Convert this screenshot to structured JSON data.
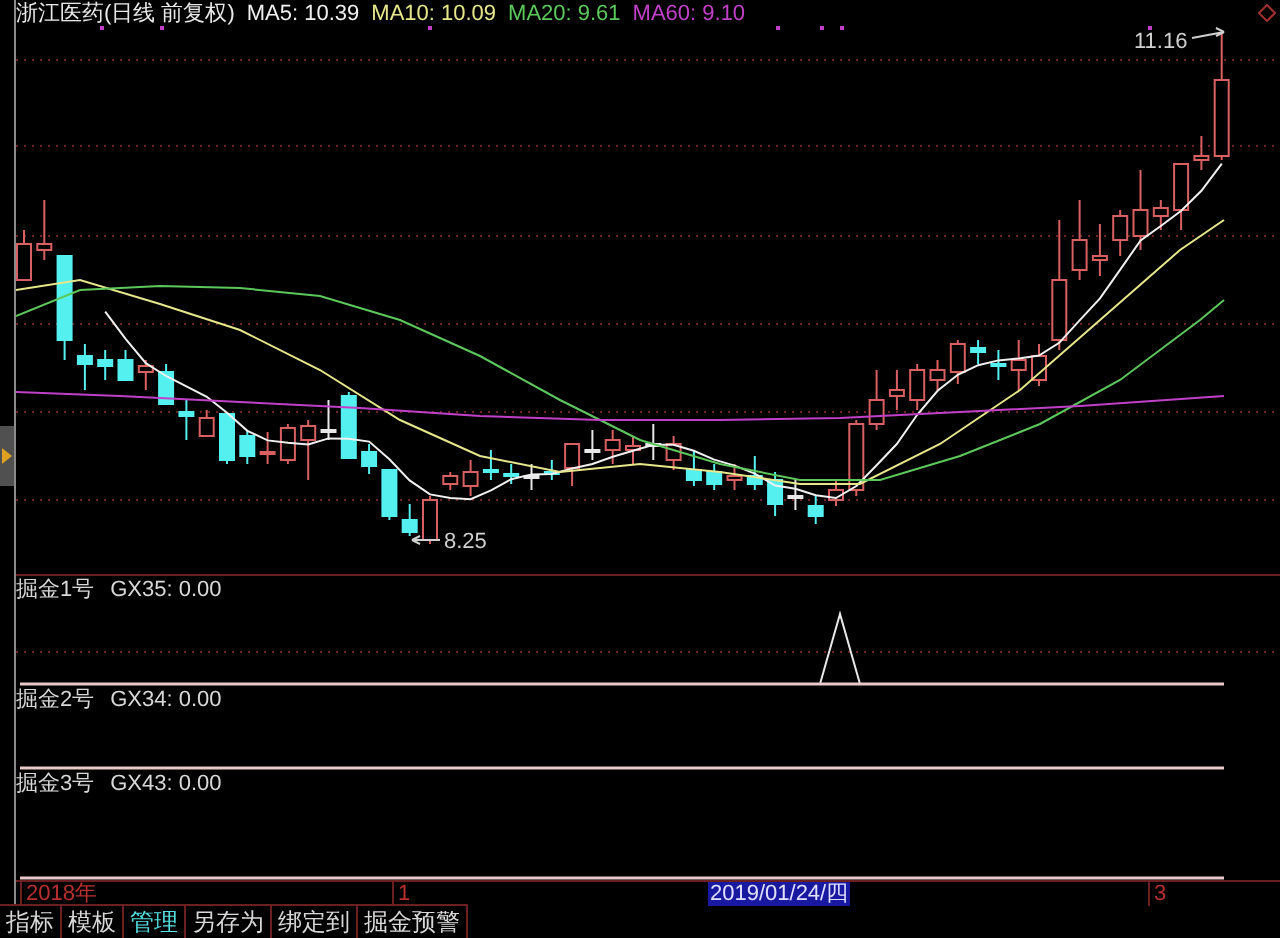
{
  "header": {
    "title": "浙江医药(日线 前复权)",
    "ma": [
      {
        "label": "MA5: 10.39",
        "color": "#f0f0f0"
      },
      {
        "label": "MA10: 10.09",
        "color": "#e6e68a"
      },
      {
        "label": "MA20: 9.61",
        "color": "#5cc85c"
      },
      {
        "label": "MA60: 9.10",
        "color": "#c040c8"
      }
    ]
  },
  "chart": {
    "low_label": "8.25",
    "high_label": "11.16"
  },
  "indicators": [
    {
      "name": "掘金1号",
      "reading": "GX35: 0.00"
    },
    {
      "name": "掘金2号",
      "reading": "GX34: 0.00"
    },
    {
      "name": "掘金3号",
      "reading": "GX43: 0.00"
    }
  ],
  "time_axis": {
    "labels": [
      "2018年",
      "1",
      "3"
    ],
    "cursor": "2019/01/24/四"
  },
  "tabs": [
    {
      "label": "指标",
      "selected": false
    },
    {
      "label": "模板",
      "selected": false
    },
    {
      "label": "管理",
      "selected": true
    },
    {
      "label": "另存为",
      "selected": false
    },
    {
      "label": "绑定到",
      "selected": false
    },
    {
      "label": "掘金预警",
      "selected": false
    }
  ]
}
